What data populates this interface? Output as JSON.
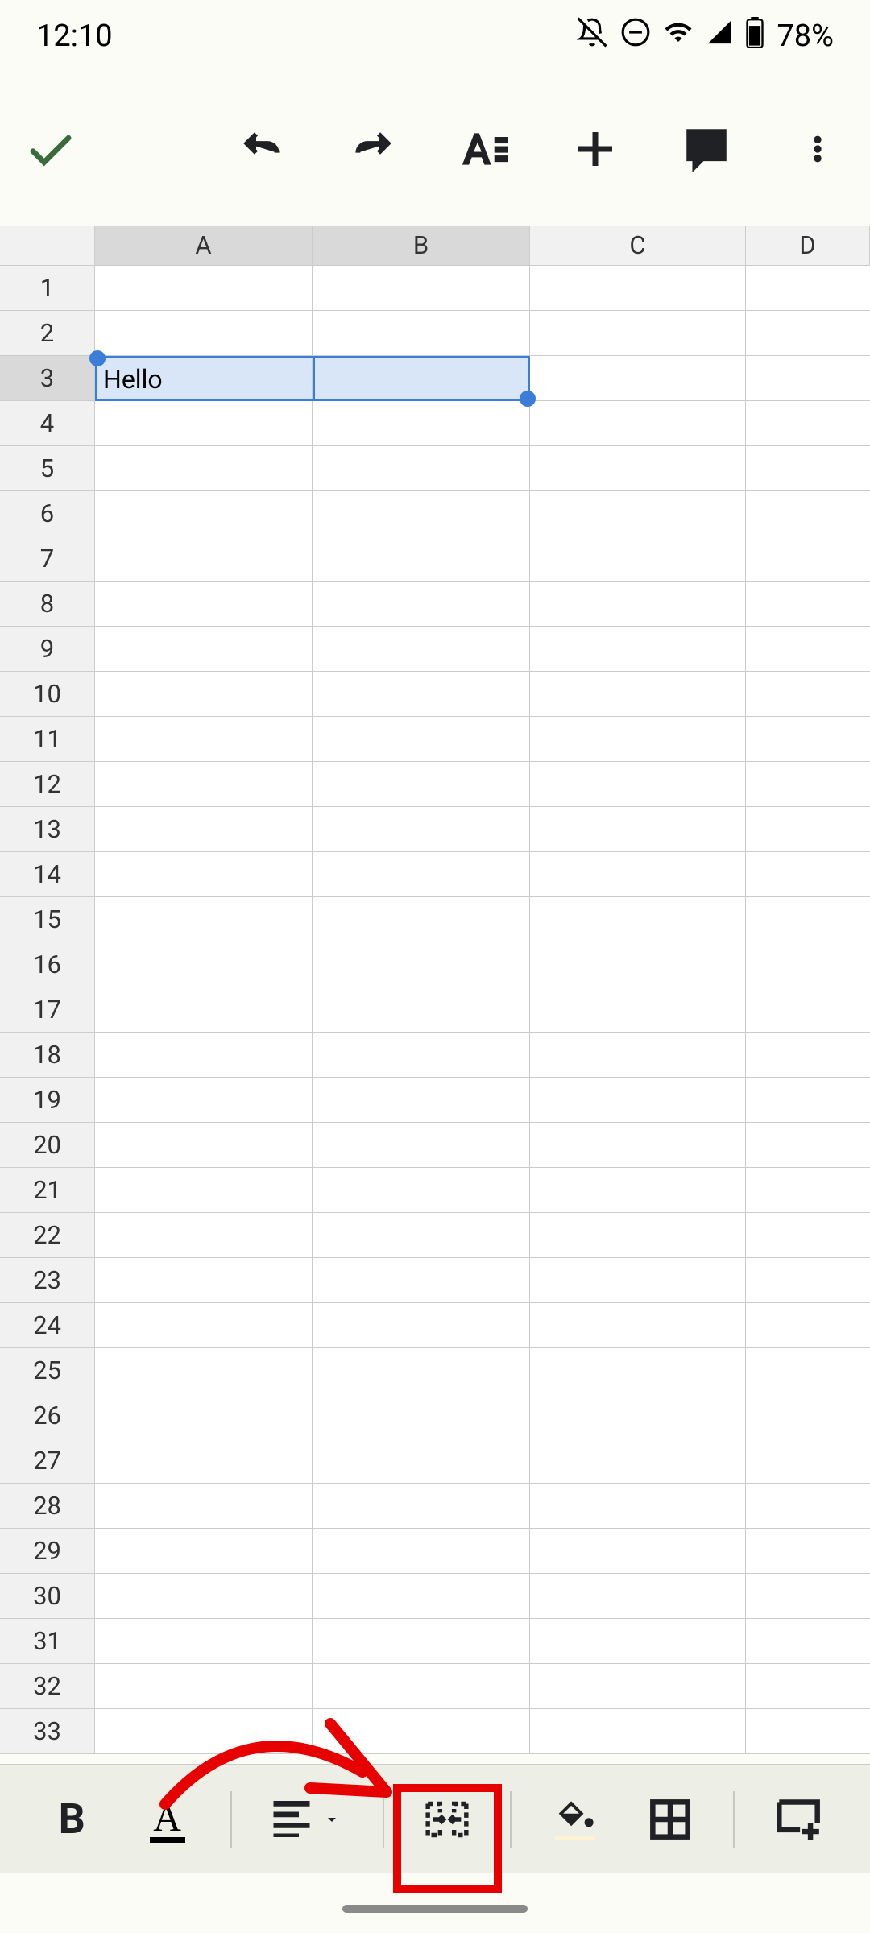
{
  "status": {
    "time": "12:10",
    "battery": "78%"
  },
  "toolbar": {
    "accept": "✓"
  },
  "sheet": {
    "column_headers": [
      "A",
      "B",
      "C",
      "D"
    ],
    "row_count": 33,
    "selected_row": 3,
    "selected_cols": [
      "A",
      "B"
    ],
    "cells": {
      "A3": "Hello"
    },
    "selection_range": "A3:B3"
  },
  "bottom_toolbar": {
    "bold": "B",
    "text_color": "A"
  }
}
